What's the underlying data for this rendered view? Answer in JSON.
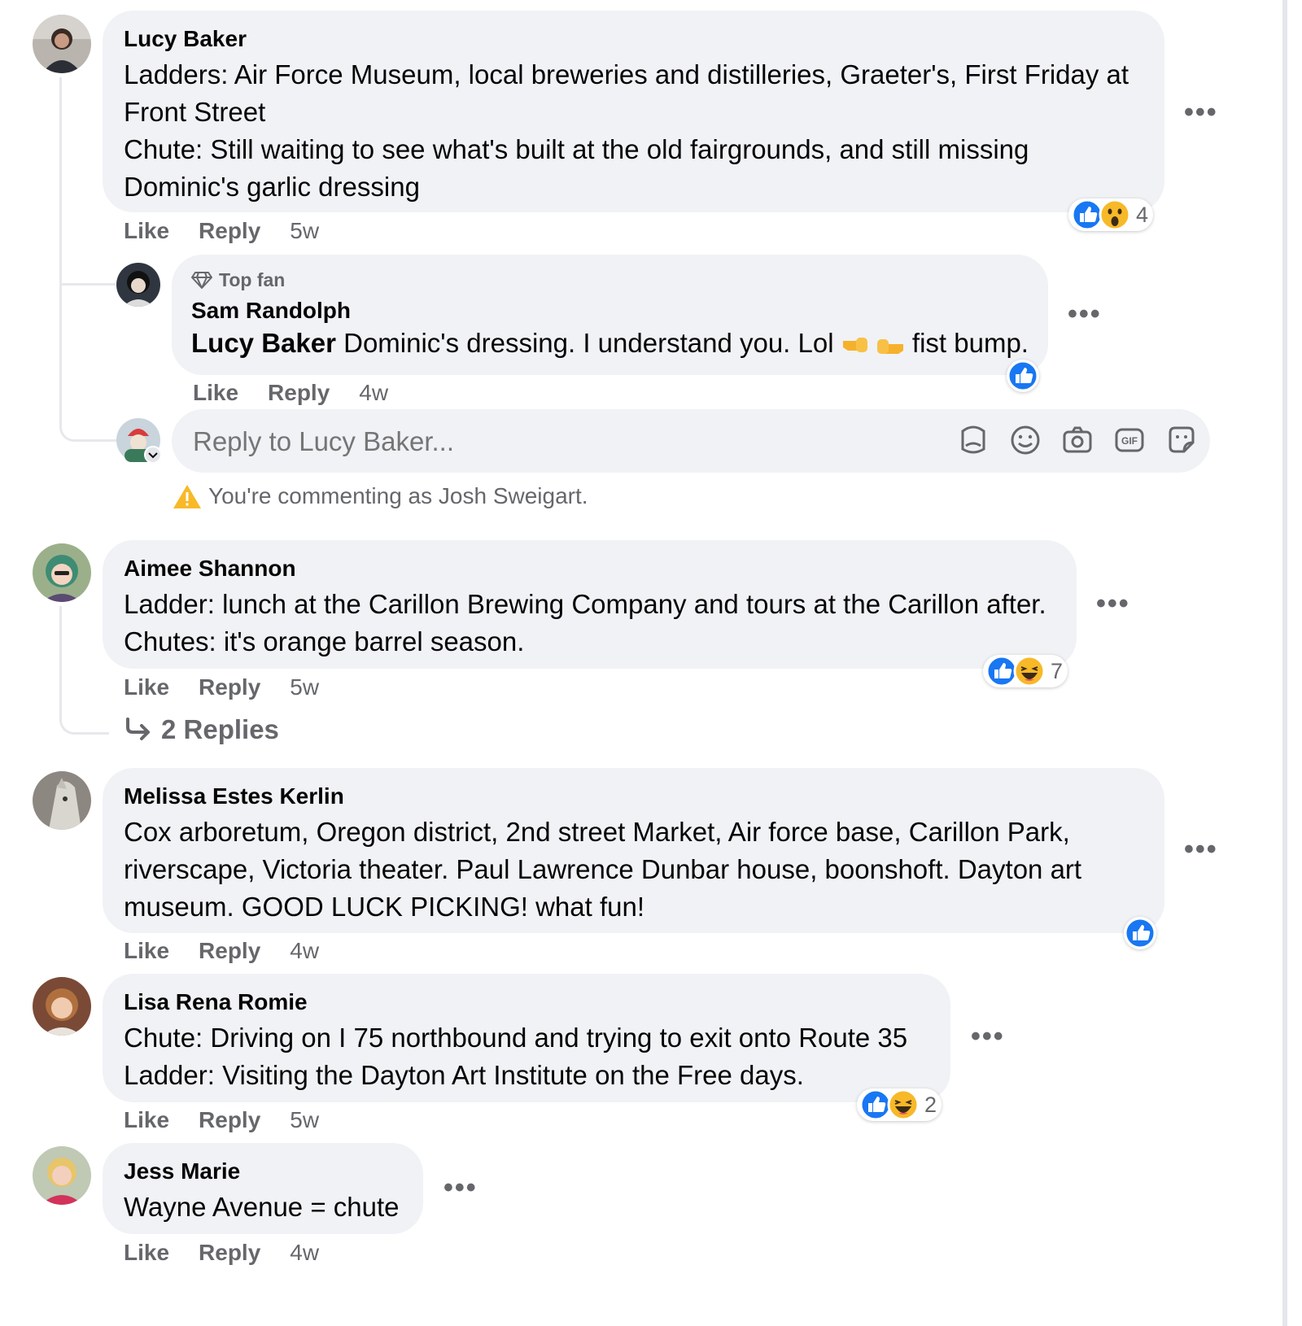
{
  "comments": [
    {
      "author": "Lucy Baker",
      "lines": [
        "Ladders: Air Force Museum, local breweries and distilleries, Graeter's, First Friday at",
        "Front Street",
        "Chute: Still waiting to see what's built at the old fairgrounds, and still missing",
        "Dominic's garlic dressing"
      ],
      "like": "Like",
      "reply": "Reply",
      "time": "5w",
      "reactions": [
        "like",
        "wow"
      ],
      "reaction_count": "4"
    },
    {
      "author": "Aimee Shannon",
      "lines": [
        "Ladder: lunch at the Carillon Brewing Company and tours at the Carillon after.",
        "Chutes: it's orange barrel season."
      ],
      "like": "Like",
      "reply": "Reply",
      "time": "5w",
      "reactions": [
        "like",
        "haha"
      ],
      "reaction_count": "7",
      "replies_link": "2 Replies"
    },
    {
      "author": "Melissa Estes Kerlin",
      "lines": [
        "Cox arboretum, Oregon district, 2nd street Market, Air force base, Carillon Park,",
        "riverscape, Victoria theater. Paul Lawrence Dunbar house, boonshoft. Dayton art",
        "museum. GOOD LUCK PICKING! what fun!"
      ],
      "like": "Like",
      "reply": "Reply",
      "time": "4w",
      "reactions": [
        "like"
      ]
    },
    {
      "author": "Lisa Rena Romie",
      "lines": [
        "Chute: Driving on I 75 northbound and trying to exit onto Route 35",
        "Ladder: Visiting the Dayton Art Institute on the Free days."
      ],
      "like": "Like",
      "reply": "Reply",
      "time": "5w",
      "reactions": [
        "like",
        "haha"
      ],
      "reaction_count": "2"
    },
    {
      "author": "Jess Marie",
      "lines": [
        "Wayne Avenue = chute"
      ],
      "like": "Like",
      "reply": "Reply",
      "time": "4w"
    }
  ],
  "reply": {
    "badge": "Top fan",
    "author": "Sam Randolph",
    "mention": "Lucy Baker",
    "text_before_emoji": "Dominic's dressing. I understand you. Lol",
    "text_after_emoji": "fist bump.",
    "like": "Like",
    "reply": "Reply",
    "time": "4w",
    "reactions": [
      "like"
    ]
  },
  "composer": {
    "placeholder": "Reply to Lucy Baker...",
    "icons": [
      "avatar-sticker-icon",
      "emoji-icon",
      "camera-icon",
      "gif-icon",
      "sticker-icon"
    ],
    "gif_label": "GIF",
    "warning": "You're commenting as Josh Sweigart."
  },
  "colors": {
    "like_blue": "#1877f2",
    "meta_gray": "#65676b",
    "bubble": "#f0f2f5",
    "warning_yellow": "#f7b928"
  }
}
